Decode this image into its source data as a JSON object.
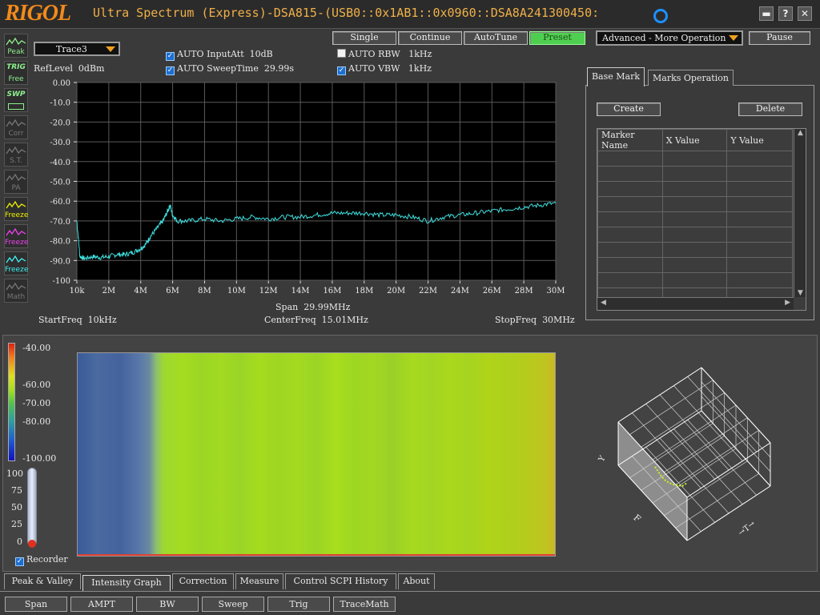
{
  "window": {
    "logo": "RIGOL",
    "title": "Ultra Spectrum (Express)-DSA815-(USB0::0x1AB1::0x0960::DSA8A241300450:",
    "minimize": "▬",
    "help": "?",
    "close": "✕"
  },
  "sidebar": [
    {
      "name": "peak",
      "label": "Peak",
      "color": "#8ef08e"
    },
    {
      "name": "trig",
      "label": "Free",
      "top": "TRIG",
      "color": "#8ef08e"
    },
    {
      "name": "swp",
      "label": "",
      "top": "SWP",
      "color": "#8ef08e"
    },
    {
      "name": "corr",
      "label": "Corr",
      "color": "#777777"
    },
    {
      "name": "st",
      "label": "S.T.",
      "color": "#777777"
    },
    {
      "name": "pa",
      "label": "PA",
      "color": "#777777"
    },
    {
      "name": "freeze-yellow",
      "label": "Freeze",
      "color": "#f0f000"
    },
    {
      "name": "freeze-magenta",
      "label": "Freeze",
      "color": "#f040f0"
    },
    {
      "name": "freeze-cyan",
      "label": "Freeze",
      "color": "#40f0f0"
    },
    {
      "name": "math",
      "label": "Math",
      "color": "#777777"
    }
  ],
  "controls": {
    "trace_select": "Trace3",
    "ref_level_label": "RefLevel",
    "ref_level_value": "0dBm",
    "input_att_label": "AUTO InputAtt",
    "input_att_value": "10dB",
    "sweep_time_label": "AUTO SweepTime",
    "sweep_time_value": "29.99s",
    "rbw_label": "AUTO RBW",
    "rbw_value": "1kHz",
    "vbw_label": "AUTO VBW",
    "vbw_value": "1kHz",
    "input_att_checked": true,
    "sweep_time_checked": true,
    "rbw_checked": false,
    "vbw_checked": true
  },
  "toolbar": {
    "single": "Single",
    "continue": "Continue",
    "autotune": "AutoTune",
    "preset": "Preset",
    "mode_select": "Advanced - More Operation",
    "pause": "Pause"
  },
  "chart_data": {
    "type": "line",
    "x_tick_labels": [
      "10k",
      "2M",
      "4M",
      "6M",
      "8M",
      "10M",
      "12M",
      "14M",
      "16M",
      "18M",
      "20M",
      "22M",
      "24M",
      "26M",
      "28M",
      "30M"
    ],
    "y_tick_labels": [
      "0.00",
      "-10.0",
      "-20.0",
      "-30.0",
      "-40.0",
      "-50.0",
      "-60.0",
      "-70.0",
      "-80.0",
      "-90.0",
      "-100"
    ],
    "ylim": [
      -100,
      0
    ],
    "xlim": [
      0.01,
      30
    ],
    "grid": true,
    "series": [
      {
        "color": "#40e0e0",
        "x": [
          0.01,
          0.2,
          0.5,
          1,
          1.5,
          2,
          2.5,
          3,
          3.5,
          4,
          4.3,
          4.6,
          5,
          5.4,
          5.7,
          5.85,
          6,
          6.3,
          7,
          8,
          9,
          10,
          11,
          12,
          13,
          14,
          15,
          16,
          17,
          18,
          19,
          20,
          21,
          22,
          23,
          24,
          25,
          26,
          27,
          28,
          29,
          30
        ],
        "values": [
          -70,
          -88,
          -89,
          -88,
          -88.5,
          -88,
          -87,
          -87,
          -86,
          -84,
          -82,
          -78,
          -74,
          -70,
          -65,
          -62,
          -67,
          -70,
          -70,
          -69,
          -70,
          -69,
          -68,
          -69,
          -68,
          -68,
          -67,
          -66,
          -66,
          -66,
          -67,
          -67,
          -68,
          -70,
          -68,
          -67,
          -66,
          -65,
          -64,
          -63,
          -62,
          -61
        ]
      }
    ],
    "span_label": "Span",
    "span_value": "29.99MHz",
    "start_label": "StartFreq",
    "start_value": "10kHz",
    "center_label": "CenterFreq",
    "center_value": "15.01MHz",
    "stop_label": "StopFreq",
    "stop_value": "30MHz"
  },
  "markers": {
    "tab_base": "Base Mark",
    "tab_ops": "Marks Operation",
    "create": "Create",
    "delete": "Delete",
    "columns": [
      "Marker Name",
      "X Value",
      "Y Value"
    ],
    "rows": 11
  },
  "intensity": {
    "scale_labels": [
      "-40.00",
      "-60.00",
      "-70.00",
      "-80.00",
      "-100.00"
    ],
    "thermo_labels": [
      "100",
      "75",
      "50",
      "25",
      "0"
    ],
    "recorder_label": "Recorder",
    "recorder_checked": true,
    "cube_labels": {
      "y": "Y",
      "f": "F",
      "t": "T"
    }
  },
  "bottom_tabs": [
    "Peak & Valley",
    "Intensity Graph",
    "Correction",
    "Measure",
    "Control SCPI History",
    "About"
  ],
  "active_bottom_tab": "Intensity Graph",
  "function_buttons": [
    "Span",
    "AMPT",
    "BW",
    "Sweep",
    "Trig",
    "TraceMath"
  ]
}
